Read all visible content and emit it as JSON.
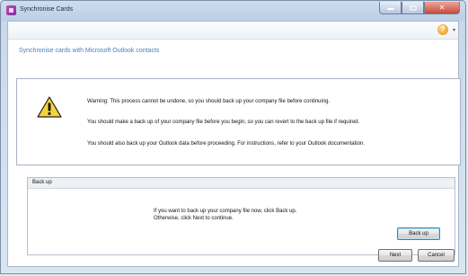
{
  "window": {
    "title": "Synchronise Cards"
  },
  "header": {
    "subtitle": "Synchronise cards with Microsoft Outlook contacts"
  },
  "warning": {
    "line1": "Warning: This process cannot be undone, so you should back up your company file before continuing.",
    "line2": "You should make a back up of your company file before you begin, so you can revert to the back up file if required.",
    "line3": "You should also back up your Outlook data before proceeding. For instructions, refer to your Outlook documentation."
  },
  "backup": {
    "heading": "Back up",
    "text1": "If you want to back up your company file now, click Back up.",
    "text2": "Otherwise, click Next to continue.",
    "button": "Back up"
  },
  "footer": {
    "next": "Next",
    "cancel": "Cancel"
  },
  "icons": {
    "app": "synchronise-cards-app-icon",
    "help": "help-icon",
    "warning": "warning-triangle-icon"
  },
  "colors": {
    "subtitle": "#4a7fb8",
    "close_button": "#c84a37"
  }
}
